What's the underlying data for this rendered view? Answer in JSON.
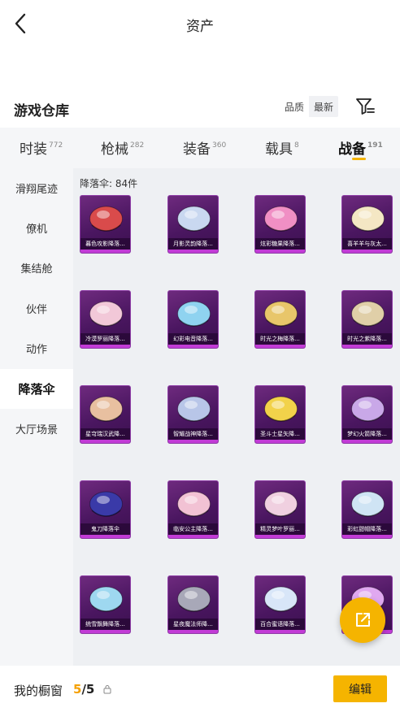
{
  "header": {
    "title": "资产",
    "back_icon": "chevron-left-icon"
  },
  "section": {
    "title": "游戏仓库",
    "sort_quality": "品质",
    "sort_newest": "最新",
    "filter_icon": "filter-icon"
  },
  "tabs": [
    {
      "label": "时装",
      "count": "772"
    },
    {
      "label": "枪械",
      "count": "282"
    },
    {
      "label": "装备",
      "count": "360"
    },
    {
      "label": "载具",
      "count": "8"
    },
    {
      "label": "战备",
      "count": "191",
      "active": true
    }
  ],
  "sidebar": [
    {
      "label": "滑翔尾迹"
    },
    {
      "label": "僚机"
    },
    {
      "label": "集结舱"
    },
    {
      "label": "伙伴"
    },
    {
      "label": "动作"
    },
    {
      "label": "降落伞",
      "active": true
    },
    {
      "label": "大厅场景"
    }
  ],
  "grid": {
    "heading": "降落伞: 84件",
    "items": [
      {
        "label": "暮色攻影降落...",
        "accent": "#d94b4b"
      },
      {
        "label": "月影灵韵降落...",
        "accent": "#c9d8f0"
      },
      {
        "label": "炫彩糖果降落...",
        "accent": "#f08fc4"
      },
      {
        "label": "喜羊羊与灰太...",
        "accent": "#f4e7c4"
      },
      {
        "label": "冷漠罗丽降落...",
        "accent": "#f2c8d8"
      },
      {
        "label": "幻彩电音降落...",
        "accent": "#8fd3f0"
      },
      {
        "label": "时光之梅降落...",
        "accent": "#e8c66a"
      },
      {
        "label": "时光之紫降落...",
        "accent": "#e0cfa8"
      },
      {
        "label": "星穹瑞汉武降...",
        "accent": "#e8c0a0"
      },
      {
        "label": "智耀战神降落...",
        "accent": "#b8c6e8"
      },
      {
        "label": "圣斗士星矢降...",
        "accent": "#f2d24a"
      },
      {
        "label": "梦幻火箭降落...",
        "accent": "#c9a8e8"
      },
      {
        "label": "鬼刀降落伞",
        "accent": "#3a3aa8"
      },
      {
        "label": "临安公主降落...",
        "accent": "#f2c2d4"
      },
      {
        "label": "精灵梦叶罗丽...",
        "accent": "#f0d0e0"
      },
      {
        "label": "彩虹甜帽降落...",
        "accent": "#cfe4f4"
      },
      {
        "label": "统雪飘舞降落...",
        "accent": "#9ed8f0"
      },
      {
        "label": "星夜魔法师降...",
        "accent": "#a8a8b8"
      },
      {
        "label": "百合蜜语降落...",
        "accent": "#d8e6f8"
      },
      {
        "label": "",
        "accent": "#e0a8f0"
      }
    ]
  },
  "fab": {
    "icon": "external-share-icon"
  },
  "footer": {
    "label": "我的橱窗",
    "current": "5",
    "separator": "/",
    "total": "5",
    "lock_icon": "lock-icon",
    "edit_label": "编辑"
  },
  "colors": {
    "accent": "#f5b400",
    "item_bg": "#4a1660",
    "item_border": "#8e3ca6"
  }
}
